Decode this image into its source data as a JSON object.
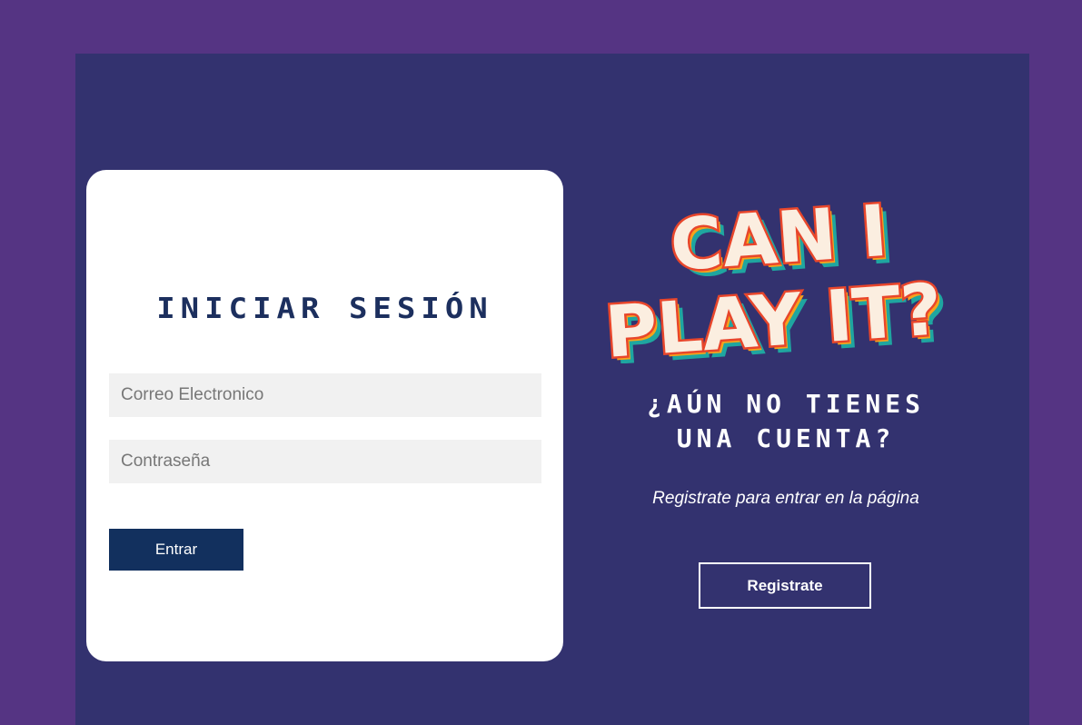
{
  "login": {
    "title": "INICIAR SESIÓN",
    "email_placeholder": "Correo Electronico",
    "password_placeholder": "Contraseña",
    "submit_label": "Entrar"
  },
  "logo": {
    "line1": "CAN I",
    "line2": "PLAY IT?"
  },
  "register": {
    "heading_line1": "¿AÚN NO TIENES",
    "heading_line2": "UNA CUENTA?",
    "text": "Registrate para entrar en la página",
    "button_label": "Registrate"
  },
  "colors": {
    "page_background": "#553483",
    "frame_background": "#33326f",
    "card_background": "#ffffff",
    "title_color": "#1c2f5e",
    "submit_button": "#12305e",
    "logo_fill": "#fbeee0",
    "logo_red": "#e8462b",
    "logo_orange": "#f7a21b",
    "logo_teal": "#1fa6a0"
  }
}
